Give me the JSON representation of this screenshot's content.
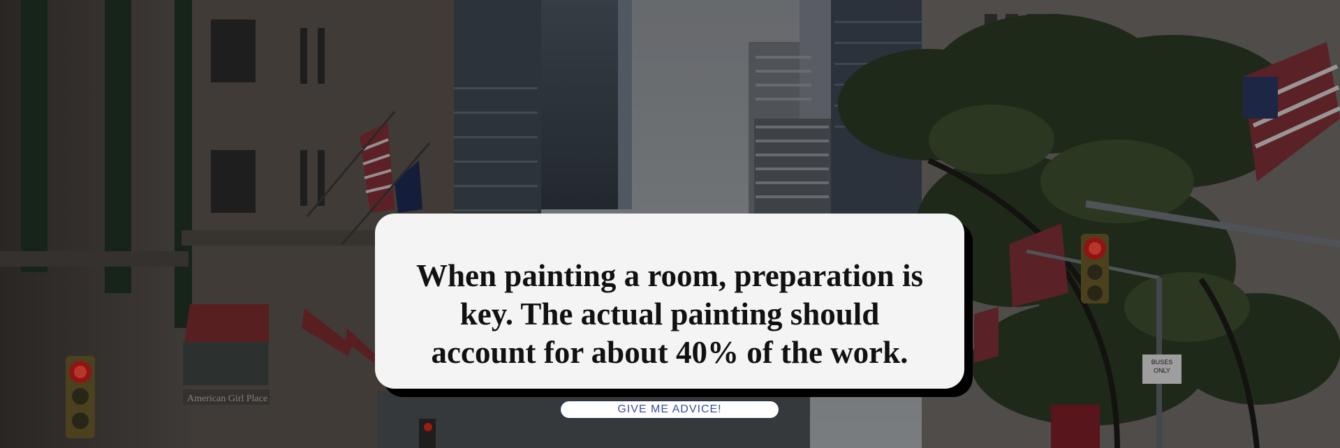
{
  "background": {
    "description_icon": "city-street-photo",
    "overlay_color": "#000000",
    "sky_color": "#9ea3a8",
    "sign_text": "BUSES ONLY",
    "storefront_text": "American Girl Place"
  },
  "advice": {
    "text": "When painting a room, preparation is key. The actual painting should account for about 40% of the work."
  },
  "button": {
    "label": "GIVE ME ADVICE!"
  },
  "colors": {
    "card_background": "#f4f4f4",
    "card_shadow": "#000000",
    "button_text": "#3a4ea0"
  }
}
